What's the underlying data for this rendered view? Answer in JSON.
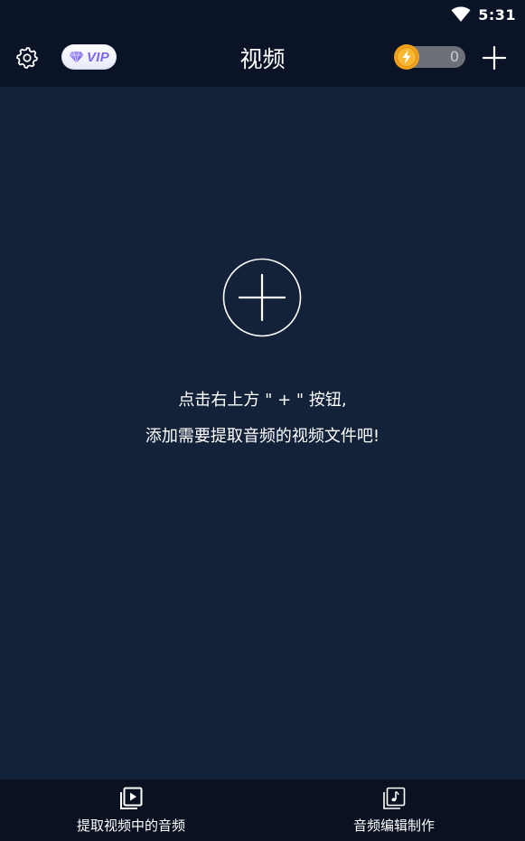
{
  "status_bar": {
    "time": "5:31",
    "wifi_icon": "wifi-icon"
  },
  "header": {
    "settings_icon": "gear-icon",
    "vip_label": "VIP",
    "title": "视频",
    "coin_count": "0",
    "coin_icon": "lightning-coin-icon",
    "add_icon": "plus-icon"
  },
  "empty_state": {
    "add_icon": "circle-plus-icon",
    "hint_line1": "点击右上方 \" + \" 按钮,",
    "hint_line2": "添加需要提取音频的视频文件吧!"
  },
  "bottom_nav": {
    "items": [
      {
        "label": "提取视频中的音频",
        "icon": "video-play-icon"
      },
      {
        "label": "音频编辑制作",
        "icon": "music-note-icon"
      }
    ]
  },
  "colors": {
    "background": "#132239",
    "bar": "#0b1426",
    "vip_text": "#7b67e8",
    "coin": "#f5a623",
    "toggle_track": "#6d7078"
  }
}
